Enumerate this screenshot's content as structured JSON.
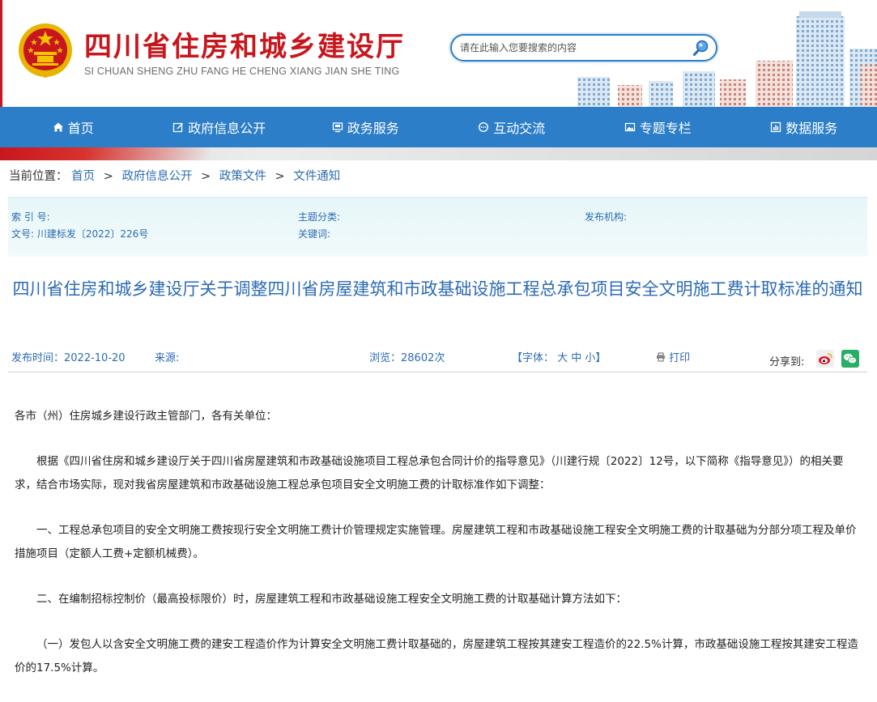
{
  "header": {
    "title": "四川省住房和城乡建设厅",
    "subtitle": "SI CHUAN SHENG ZHU FANG HE CHENG XIANG JIAN SHE TING",
    "search_placeholder": "请在此输入您要搜索的内容"
  },
  "nav": {
    "items": [
      {
        "label": "首页",
        "icon": "home-icon"
      },
      {
        "label": "政府信息公开",
        "icon": "edit-icon"
      },
      {
        "label": "政务服务",
        "icon": "monitor-icon"
      },
      {
        "label": "互动交流",
        "icon": "chat-icon"
      },
      {
        "label": "专题专栏",
        "icon": "image-icon"
      },
      {
        "label": "数据服务",
        "icon": "bar-chart-icon"
      }
    ]
  },
  "breadcrumb": {
    "prefix": "当前位置：",
    "items": [
      "首页",
      "政府信息公开",
      "政策文件",
      "文件通知"
    ],
    "separator": ">"
  },
  "info": {
    "index_no": "索 引 号:",
    "topic": "主题分类:",
    "publisher": "发布机构:",
    "doc_no": "文号: 川建标发〔2022〕226号",
    "keywords": "关键词:"
  },
  "article": {
    "title": "四川省住房和城乡建设厅关于调整四川省房屋建筑和市政基础设施工程总承包项目安全文明施工费计取标准的通知",
    "publish_time": "发布时间：2022-10-20",
    "source": "来源:",
    "views": "浏览：28602次",
    "font_size": "【字体：  大 中 小】",
    "print": "打印",
    "share_label": "分享到:",
    "paragraphs": [
      "各市（州）住房城乡建设行政主管部门，各有关单位：",
      "根据《四川省住房和城乡建设厅关于四川省房屋建筑和市政基础设施项目工程总承包合同计价的指导意见》（川建行规〔2022〕12号，以下简称《指导意见》）的相关要求，结合市场实际，现对我省房屋建筑和市政基础设施工程总承包项目安全文明施工费的计取标准作如下调整：",
      "一、工程总承包项目的安全文明施工费按现行安全文明施工费计价管理规定实施管理。房屋建筑工程和市政基础设施工程安全文明施工费的计取基础为分部分项工程及单价措施项目（定额人工费+定额机械费）。",
      "二、在编制招标控制价（最高投标限价）时，房屋建筑工程和市政基础设施工程安全文明施工费的计取基础计算方法如下：",
      "（一）发包人以含安全文明施工费的建安工程造价作为计算安全文明施工费计取基础的，房屋建筑工程按其建安工程造价的22.5%计算，市政基础设施工程按其建安工程造价的17.5%计算。"
    ]
  },
  "colors": {
    "brand_red": "#c8161d",
    "nav_blue": "#2c7ec9",
    "link_blue": "#2c6bb3"
  }
}
